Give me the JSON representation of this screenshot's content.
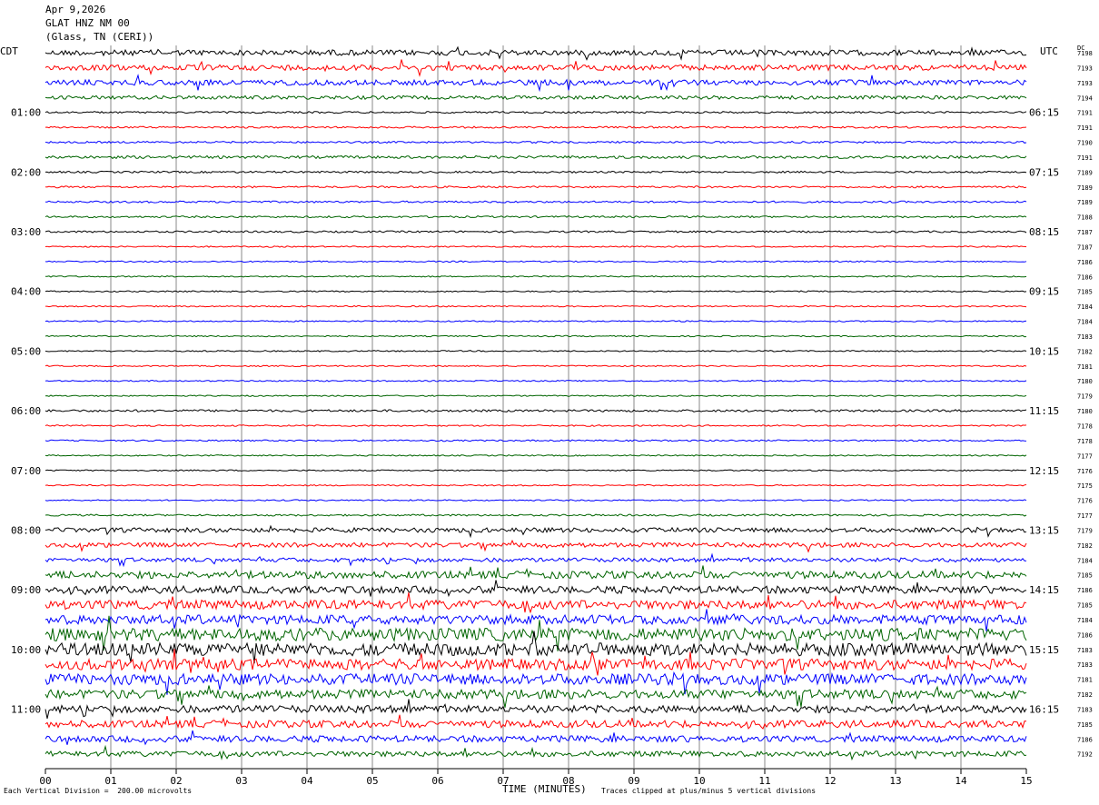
{
  "header": {
    "date": "Apr 9,2026",
    "station": "GLAT HNZ NM 00",
    "location": "(Glass, TN (CERI))"
  },
  "left_label": "CDT",
  "right_label": "UTC",
  "dc_label": "DC",
  "footer": {
    "scale_note": "Each Vertical Division =  200.00 microvolts",
    "xlabel": "TIME (MINUTES)",
    "clip_note": "Traces clipped at plus/minus 5 vertical divisions"
  },
  "colors": [
    "#000000",
    "#ff0000",
    "#0000ff",
    "#006400"
  ],
  "chart_data": {
    "type": "line",
    "title": "GLAT HNZ NM 00",
    "xlabel": "TIME (MINUTES)",
    "xlim": [
      0,
      15
    ],
    "x_ticks": [
      "00",
      "01",
      "02",
      "03",
      "04",
      "05",
      "06",
      "07",
      "08",
      "09",
      "10",
      "11",
      "12",
      "13",
      "14",
      "15"
    ],
    "grid": true,
    "trace_count": 48,
    "trace_minutes": 15,
    "left_time_labels": [
      "01:00",
      "02:00",
      "03:00",
      "04:00",
      "05:00",
      "06:00",
      "07:00",
      "08:00",
      "09:00",
      "10:00",
      "11:00"
    ],
    "right_time_labels": [
      "06:15",
      "07:15",
      "08:15",
      "09:15",
      "10:15",
      "11:15",
      "12:15",
      "13:15",
      "14:15",
      "15:15",
      "16:15"
    ],
    "dc_offsets": [
      7198,
      7193,
      7193,
      7194,
      7191,
      7191,
      7190,
      7191,
      7189,
      7189,
      7189,
      7188,
      7187,
      7187,
      7186,
      7186,
      7185,
      7184,
      7184,
      7183,
      7182,
      7181,
      7180,
      7179,
      7180,
      7178,
      7178,
      7177,
      7176,
      7175,
      7176,
      7177,
      7179,
      7182,
      7184,
      7185,
      7186,
      7185,
      7184,
      7186,
      7183,
      7183,
      7181,
      7182,
      7183,
      7185,
      7186,
      7192
    ],
    "noise_levels": [
      3,
      3,
      3,
      2,
      1,
      1,
      1,
      1.5,
      1,
      1,
      1,
      1,
      1,
      0.7,
      0.7,
      0.7,
      0.7,
      0.7,
      0.7,
      0.7,
      0.7,
      0.7,
      0.7,
      0.7,
      1.2,
      0.8,
      0.8,
      0.7,
      0.7,
      0.7,
      0.7,
      1,
      2.5,
      2.5,
      2.2,
      4,
      4,
      5,
      5,
      7,
      7,
      6,
      6,
      5,
      4,
      4,
      3.5,
      3
    ]
  }
}
